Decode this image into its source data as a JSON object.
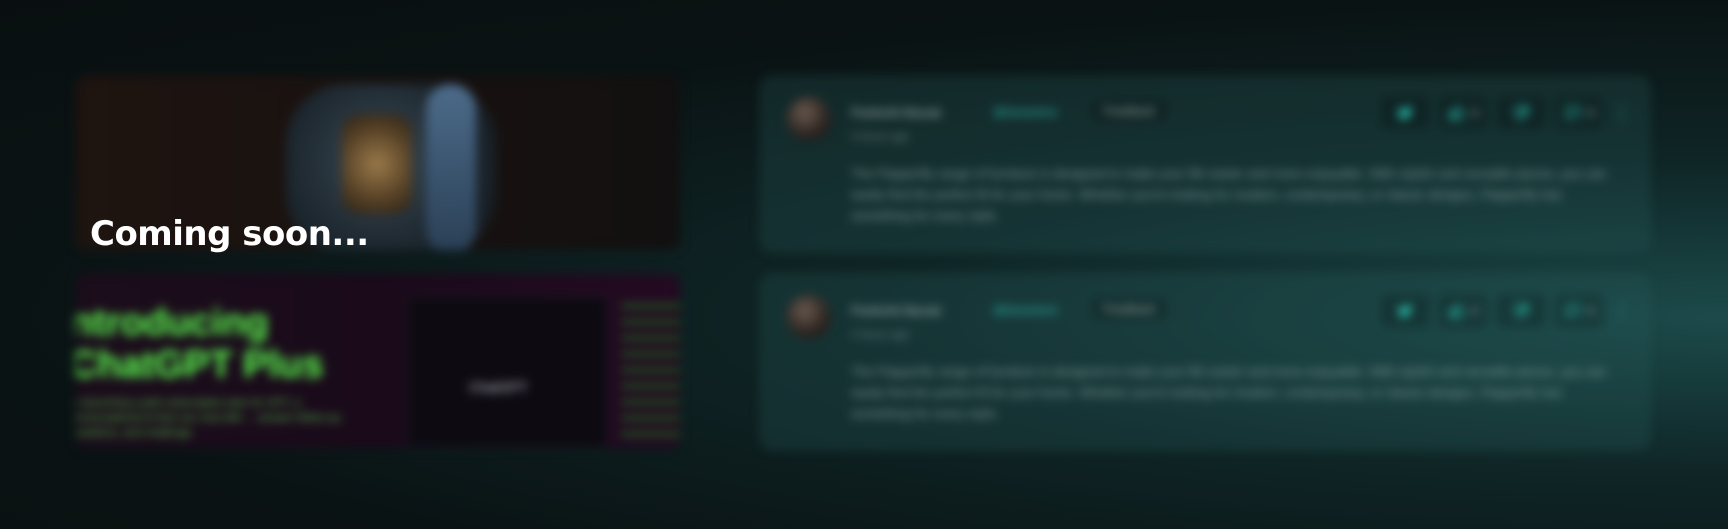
{
  "overlay": {
    "title": "Coming soon..."
  },
  "cards_left": [
    {
      "kind": "product-image",
      "alt": "smartwatch"
    },
    {
      "kind": "promo-image",
      "title_line1": "ntroducing",
      "title_line2": "ChatGPT Plus",
      "text": "re launching a pilot subscription plan for GPT, a conversational AI that can chat with ... answer follow-up questions, and challenge",
      "screen_label": "ChatGPT"
    }
  ],
  "feedback": [
    {
      "name": "Parikshit Banak",
      "handle": "@banaviere",
      "tag": "Feedback",
      "time": "3 hours ago",
      "body": "The Flapperfly range of furniture is designed to make your life easier and more enjoyable. With stylish and versatile pieces, you can easily find the perfect fit for your home. Whether you're looking for modern, contemporary, or classic designs, Flapperfly has something for every style.",
      "likes": "0",
      "comments": "0"
    },
    {
      "name": "Parikshit Banak",
      "handle": "@banaviere",
      "tag": "Feedback",
      "time": "3 hours ago",
      "body": "The Flapperfly range of furniture is designed to make your life easier and more enjoyable. With stylish and versatile pieces, you can easily find the perfect fit for your home. Whether you're looking for modern, contemporary, or classic designs, Flapperfly has something for every style.",
      "likes": "0",
      "comments": "0"
    }
  ],
  "icons": {
    "share": "twitter-icon",
    "like": "thumbs-up-icon",
    "dislike": "thumbs-down-icon",
    "comment": "comment-icon",
    "more": "more-vertical-icon"
  },
  "colors": {
    "accent": "#2cc7b6",
    "promo_green": "#5cff4f"
  }
}
